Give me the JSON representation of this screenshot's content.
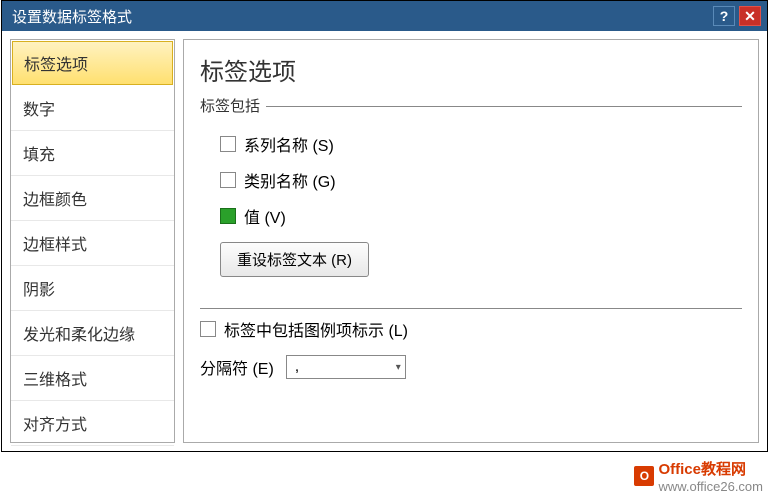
{
  "titlebar": {
    "title": "设置数据标签格式",
    "help": "?",
    "close": "✕"
  },
  "sidebar": {
    "items": [
      "标签选项",
      "数字",
      "填充",
      "边框颜色",
      "边框样式",
      "阴影",
      "发光和柔化边缘",
      "三维格式",
      "对齐方式"
    ],
    "selected_index": 0
  },
  "panel": {
    "title": "标签选项",
    "group_label": "标签包括",
    "options": {
      "series_name": {
        "label": "系列名称 (S)",
        "checked": false
      },
      "category_name": {
        "label": "类别名称 (G)",
        "checked": false
      },
      "value": {
        "label": "值 (V)",
        "checked": true
      }
    },
    "reset_button": "重设标签文本 (R)",
    "include_legend_key": {
      "label": "标签中包括图例项标示 (L)",
      "checked": false
    },
    "separator_label": "分隔符 (E)",
    "separator_value": ","
  },
  "watermark": {
    "brand": "Office教程网",
    "url": "www.office26.com",
    "logo_letter": "O"
  }
}
